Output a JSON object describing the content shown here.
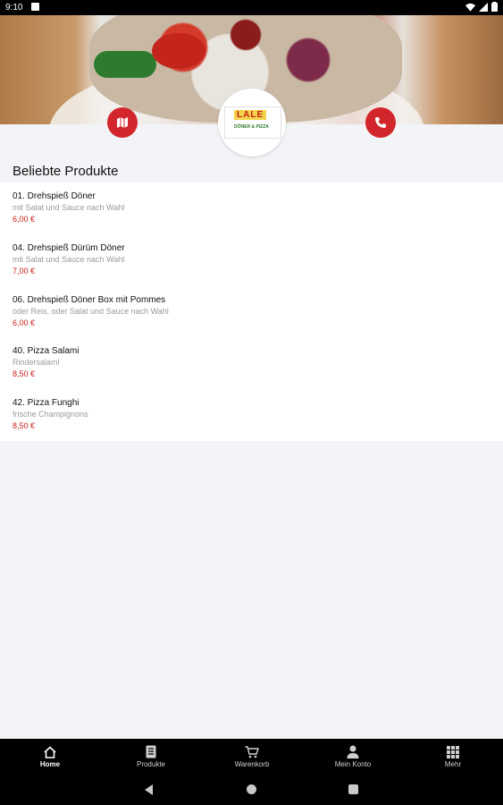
{
  "status_bar": {
    "time": "9:10"
  },
  "header": {
    "logo_brand": "LALE",
    "logo_subtitle": "DÖNER & PIZZA"
  },
  "section": {
    "title": "Beliebte Produkte"
  },
  "products": [
    {
      "name": "01. Drehspieß Döner",
      "description": "mit Salat und Sauce nach Wahl",
      "price": "6,00 €"
    },
    {
      "name": "04. Drehspieß Dürüm Döner",
      "description": "mit Salat und Sauce nach Wahl",
      "price": "7,00 €"
    },
    {
      "name": "06. Drehspieß Döner Box mit Pommes",
      "description": "oder Reis, oder Salat und Sauce nach Wahl",
      "price": "6,00 €"
    },
    {
      "name": "40. Pizza Salami",
      "description": "Rindersalami",
      "price": "8,50 €"
    },
    {
      "name": "42. Pizza Funghi",
      "description": "frische Champignons",
      "price": "8,50 €"
    }
  ],
  "bottom_nav": [
    {
      "label": "Home",
      "icon": "home-icon",
      "active": true
    },
    {
      "label": "Produkte",
      "icon": "menu-book-icon",
      "active": false
    },
    {
      "label": "Warenkorb",
      "icon": "cart-icon",
      "active": false
    },
    {
      "label": "Mein Konto",
      "icon": "person-icon",
      "active": false
    },
    {
      "label": "Mehr",
      "icon": "grid-icon",
      "active": false
    }
  ],
  "colors": {
    "accent": "#d2262c",
    "price": "#c8201c",
    "background": "#f2f4f7"
  }
}
